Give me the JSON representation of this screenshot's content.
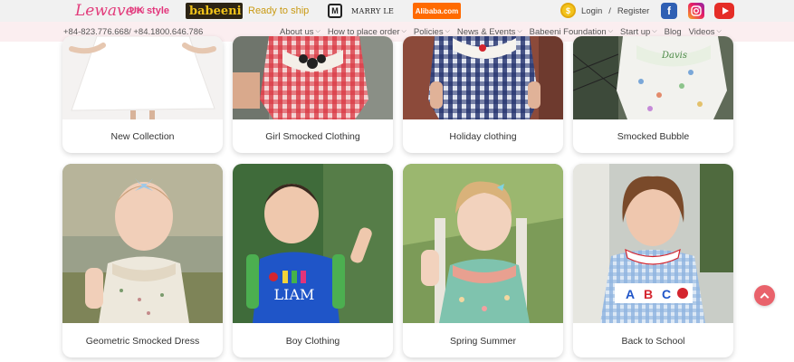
{
  "topbar": {
    "lewave_logo": "Lewave",
    "lewave_tm": "TM",
    "uk_style": "UK style",
    "babeeni_logo": "babeeni",
    "ready_to_ship": "Ready to ship",
    "marry_le": "MARRY LE",
    "alibaba": "Alibaba.com",
    "login": "Login",
    "separator": "/",
    "register": "Register"
  },
  "nav": {
    "phones": "+84-823.776.668/ +84.1800.646.786",
    "items": [
      {
        "label": "About us",
        "has_dropdown": true
      },
      {
        "label": "How to place order",
        "has_dropdown": true
      },
      {
        "label": "Policies",
        "has_dropdown": true
      },
      {
        "label": "News & Events",
        "has_dropdown": true
      },
      {
        "label": "Babeeni Foundation",
        "has_dropdown": true
      },
      {
        "label": "Start up",
        "has_dropdown": true
      },
      {
        "label": "Blog",
        "has_dropdown": false
      },
      {
        "label": "Videos",
        "has_dropdown": true
      }
    ]
  },
  "categories": [
    {
      "label": "New Collection"
    },
    {
      "label": "Girl Smocked Clothing"
    },
    {
      "label": "Holiday clothing"
    },
    {
      "label": "Smocked Bubble"
    },
    {
      "label": "Geometric Smocked Dress"
    },
    {
      "label": "Boy Clothing"
    },
    {
      "label": "Spring Summer"
    },
    {
      "label": "Back to School"
    }
  ],
  "colors": {
    "accent_pink": "#e2347a",
    "nav_bg": "#fbeef0",
    "topbar_bg": "#f1f1f1",
    "scroll_top": "#e9626b"
  },
  "icons": {
    "scroll_top": "chevron-up-icon",
    "facebook": "facebook-icon",
    "instagram": "instagram-icon",
    "youtube": "youtube-icon",
    "coin": "coin-icon"
  }
}
